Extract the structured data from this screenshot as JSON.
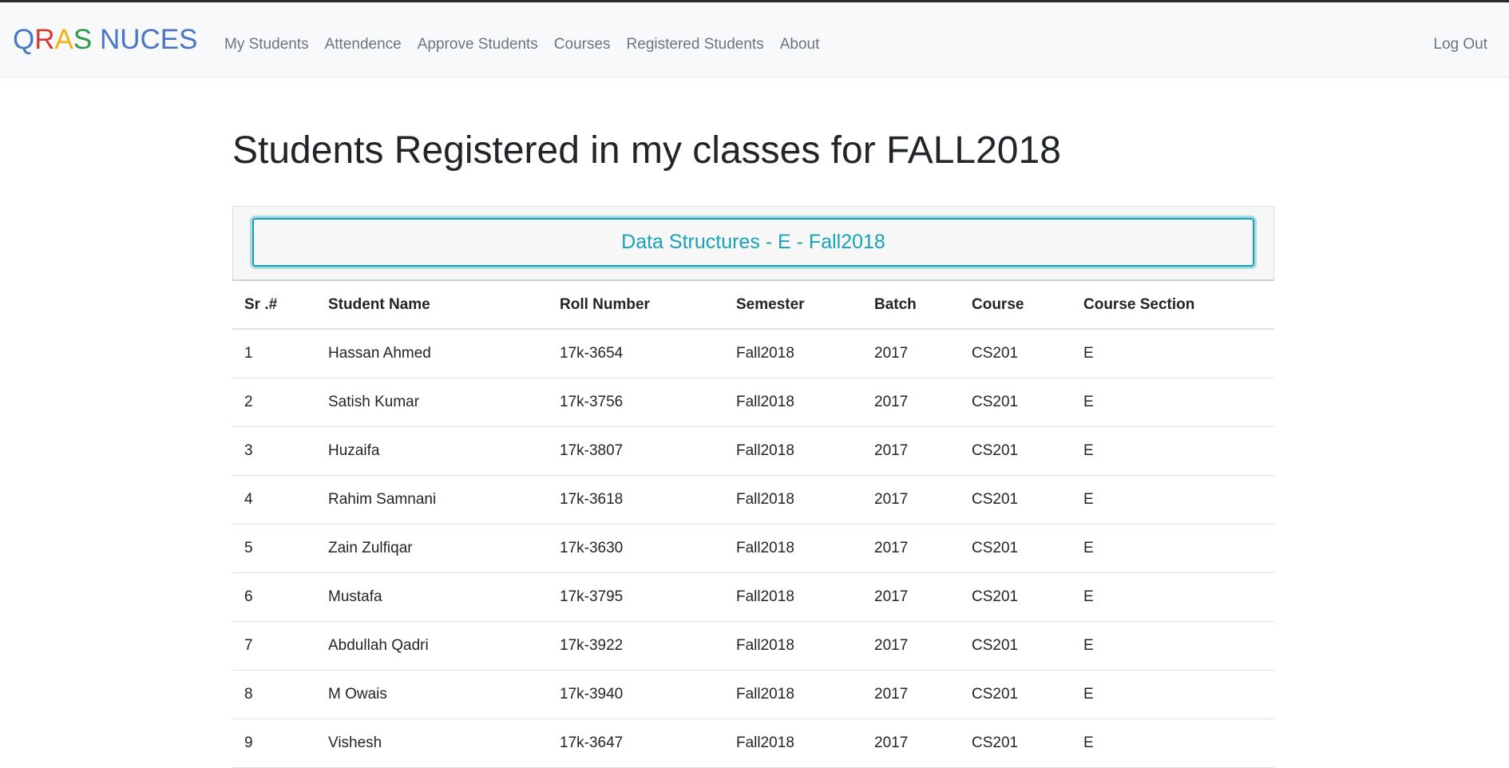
{
  "navbar": {
    "brand": {
      "letters": [
        {
          "char": "Q",
          "color": "#4a76c4"
        },
        {
          "char": "R",
          "color": "#d93a30"
        },
        {
          "char": "A",
          "color": "#f2b21b"
        },
        {
          "char": "S",
          "color": "#2e9b4a"
        },
        {
          "char": " NUCES",
          "color": "#4a76c4"
        }
      ]
    },
    "links": [
      {
        "label": "My Students"
      },
      {
        "label": "Attendence"
      },
      {
        "label": "Approve Students"
      },
      {
        "label": "Courses"
      },
      {
        "label": "Registered Students"
      },
      {
        "label": "About"
      }
    ],
    "logout_label": "Log Out"
  },
  "page": {
    "title": "Students Registered in my classes for FALL2018"
  },
  "course_panel": {
    "button_label": "Data Structures - E - Fall2018",
    "accent_color": "#17a2b8"
  },
  "table": {
    "headers": [
      "Sr .#",
      "Student Name",
      "Roll Number",
      "Semester",
      "Batch",
      "Course",
      "Course Section"
    ],
    "rows": [
      [
        "1",
        "Hassan Ahmed",
        "17k-3654",
        "Fall2018",
        "2017",
        "CS201",
        "E"
      ],
      [
        "2",
        "Satish Kumar",
        "17k-3756",
        "Fall2018",
        "2017",
        "CS201",
        "E"
      ],
      [
        "3",
        "Huzaifa",
        "17k-3807",
        "Fall2018",
        "2017",
        "CS201",
        "E"
      ],
      [
        "4",
        "Rahim Samnani",
        "17k-3618",
        "Fall2018",
        "2017",
        "CS201",
        "E"
      ],
      [
        "5",
        "Zain Zulfiqar",
        "17k-3630",
        "Fall2018",
        "2017",
        "CS201",
        "E"
      ],
      [
        "6",
        "Mustafa",
        "17k-3795",
        "Fall2018",
        "2017",
        "CS201",
        "E"
      ],
      [
        "7",
        "Abdullah Qadri",
        "17k-3922",
        "Fall2018",
        "2017",
        "CS201",
        "E"
      ],
      [
        "8",
        "M Owais",
        "17k-3940",
        "Fall2018",
        "2017",
        "CS201",
        "E"
      ],
      [
        "9",
        "Vishesh",
        "17k-3647",
        "Fall2018",
        "2017",
        "CS201",
        "E"
      ]
    ]
  }
}
